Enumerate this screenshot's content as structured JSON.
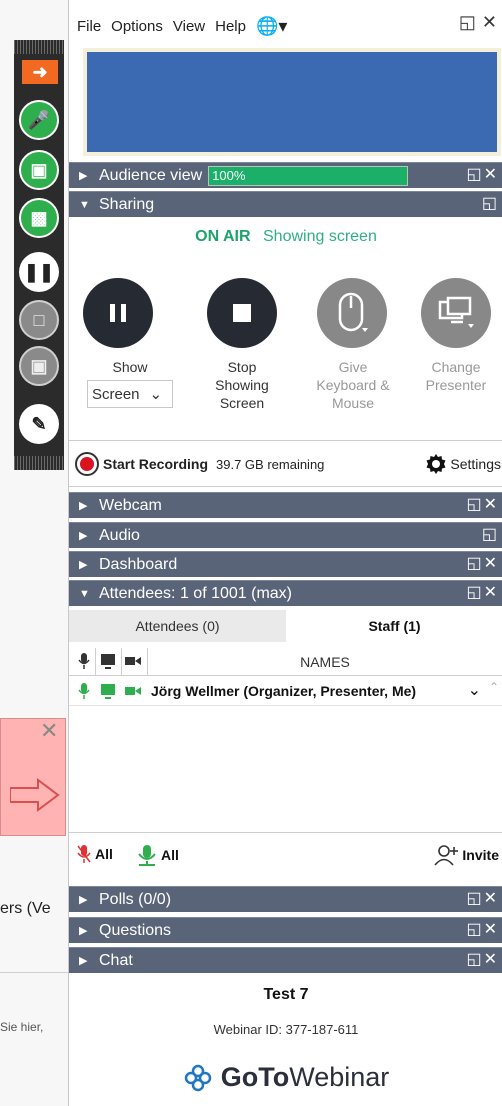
{
  "menu": {
    "items": [
      "File",
      "Options",
      "View",
      "Help"
    ],
    "globe_icon": "globe-icon"
  },
  "background": {
    "text_left": "ers (Ve",
    "text_left2": "Sie hier,"
  },
  "sections": {
    "audience_view": {
      "label": "Audience view",
      "volume_label": "100%",
      "level": 1.0
    },
    "sharing": {
      "label": "Sharing"
    },
    "webcam": {
      "label": "Webcam"
    },
    "audio": {
      "label": "Audio"
    },
    "dashboard": {
      "label": "Dashboard"
    },
    "attendees": {
      "label": "Attendees:  1 of 1001 (max)"
    },
    "polls": {
      "label": "Polls (0/0)"
    },
    "questions": {
      "label": "Questions"
    },
    "chat": {
      "label": "Chat"
    }
  },
  "sharing": {
    "status_on_air": "ON AIR",
    "status_detail": "Showing screen",
    "buttons": {
      "show": {
        "label": "Show",
        "dropdown_value": "Screen"
      },
      "stop": {
        "label1": "Stop",
        "label2": "Showing",
        "label3": "Screen"
      },
      "give": {
        "label1": "Give",
        "label2": "Keyboard &",
        "label3": "Mouse"
      },
      "change": {
        "label1": "Change",
        "label2": "Presenter"
      }
    }
  },
  "recording": {
    "start_label": "Start Recording",
    "remaining": "39.7 GB remaining",
    "settings_label": "Settings"
  },
  "attendees_tabs": {
    "attendees": "Attendees (0)",
    "staff": "Staff (1)"
  },
  "names_header": "NAMES",
  "staff_rows": [
    {
      "name": "Jörg Wellmer (Organizer, Presenter, Me)"
    }
  ],
  "bottom_actions": {
    "mute_all": "All",
    "unmute_all": "All",
    "invite": "Invite"
  },
  "footer": {
    "title": "Test 7",
    "webinar_id": "Webinar ID: 377-187-611",
    "logo_goto": "GoTo",
    "logo_webinar": "Webinar"
  },
  "colors": {
    "section_bar": "#5a6478",
    "accent_green": "#1ea46a",
    "record_red": "#d9131f",
    "preview_blue": "#3b6ab3"
  }
}
